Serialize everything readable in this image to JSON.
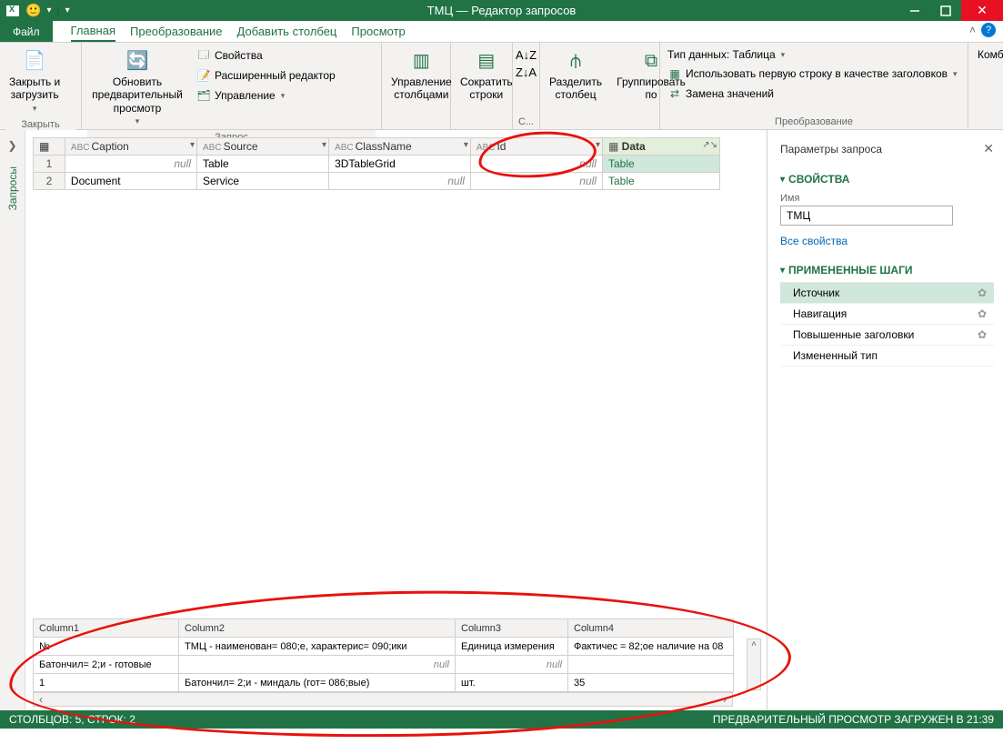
{
  "titlebar": {
    "title": "ТМЦ — Редактор запросов"
  },
  "menubar": {
    "file": "Файл",
    "tabs": [
      "Главная",
      "Преобразование",
      "Добавить столбец",
      "Просмотр"
    ]
  },
  "ribbon": {
    "close": {
      "label": "Закрыть и\nзагрузить",
      "group": "Закрыть"
    },
    "query": {
      "refresh": "Обновить предварительный\nпросмотр",
      "props": "Свойства",
      "adv": "Расширенный редактор",
      "manage": "Управление",
      "group": "Запрос"
    },
    "cols": {
      "manage_cols": "Управление\nстолбцами",
      "reduce_rows": "Сократить\nстроки",
      "sort": "С...",
      "split": "Разделить\nстолбец",
      "group_by": "Группировать\nпо"
    },
    "transform": {
      "dtype": "Тип данных: Таблица",
      "firstrow": "Использовать первую строку в качестве заголовков",
      "replace": "Замена значений",
      "group": "Преобразование"
    },
    "comb": "Комби"
  },
  "leftrail": "Запросы",
  "grid1": {
    "headers": [
      "",
      "Caption",
      "Source",
      "ClassName",
      "Id",
      "Data"
    ],
    "rows": [
      {
        "n": "1",
        "caption_null": true,
        "source": "Table",
        "class": "3DTableGrid",
        "id_null": true,
        "data": "Table"
      },
      {
        "n": "2",
        "caption": "Document",
        "source": "Service",
        "class_null": true,
        "id_null": true,
        "data": "Table"
      }
    ]
  },
  "preview": {
    "headers": [
      "Column1",
      "Column2",
      "Column3",
      "Column4"
    ],
    "rows": [
      [
        "№",
        "ТМЦ - наименован= 080;е, характерис= 090;ики",
        "Единица измерения",
        "Фактичес = 82;ое наличие на 08"
      ],
      [
        "Батончил= 2;и - готовые",
        null,
        null,
        ""
      ],
      [
        "1",
        "Батончил= 2;и - миндаль  (гот= 086;вые)",
        "шт.",
        "35"
      ]
    ]
  },
  "right": {
    "title": "Параметры запроса",
    "props": "СВОЙСТВА",
    "name_label": "Имя",
    "name_value": "ТМЦ",
    "all_props": "Все свойства",
    "steps_title": "ПРИМЕНЕННЫЕ ШАГИ",
    "steps": [
      "Источник",
      "Навигация",
      "Повышенные заголовки",
      "Измененный тип"
    ]
  },
  "status": {
    "left": "СТОЛБЦОВ: 5, СТРОК: 2",
    "right": "ПРЕДВАРИТЕЛЬНЫЙ ПРОСМОТР ЗАГРУЖЕН В 21:39"
  }
}
